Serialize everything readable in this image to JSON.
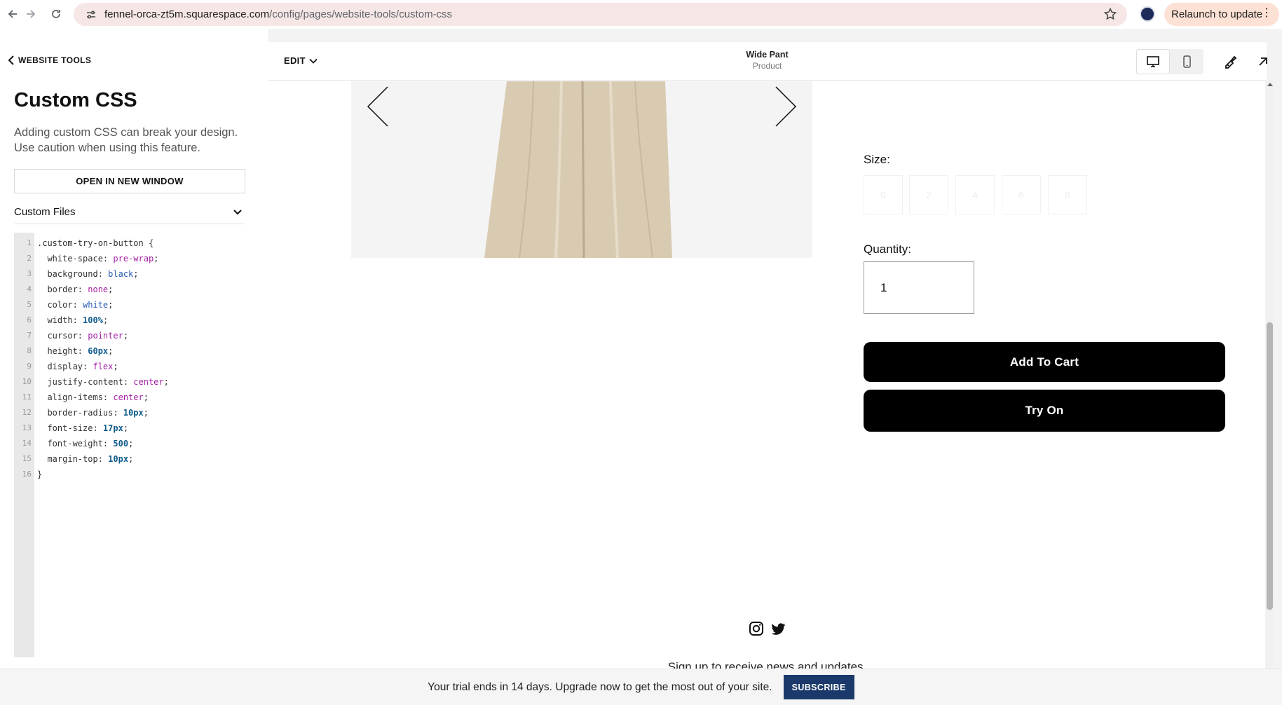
{
  "browser": {
    "url_host": "fennel-orca-zt5m.squarespace.com",
    "url_path": "/config/pages/website-tools/custom-css",
    "relaunch_label": "Relaunch to update"
  },
  "panel": {
    "back_label": "WEBSITE TOOLS",
    "title": "Custom CSS",
    "description": "Adding custom CSS can break your design. Use caution when using this feature.",
    "open_window_label": "OPEN IN NEW WINDOW",
    "custom_files_label": "Custom Files"
  },
  "code": {
    "line_numbers": [
      "1",
      "2",
      "3",
      "4",
      "5",
      "6",
      "7",
      "8",
      "9",
      "10",
      "11",
      "12",
      "13",
      "14",
      "15",
      "16"
    ],
    "lines": [
      [
        {
          "t": ".custom-try-on-button {",
          "c": ""
        }
      ],
      [
        {
          "t": "  white-space: ",
          "c": ""
        },
        {
          "t": "pre-wrap",
          "c": "kw"
        },
        {
          "t": ";",
          "c": ""
        }
      ],
      [
        {
          "t": "  background: ",
          "c": ""
        },
        {
          "t": "black",
          "c": "cl"
        },
        {
          "t": ";",
          "c": ""
        }
      ],
      [
        {
          "t": "  border: ",
          "c": ""
        },
        {
          "t": "none",
          "c": "kw"
        },
        {
          "t": ";",
          "c": ""
        }
      ],
      [
        {
          "t": "  color: ",
          "c": ""
        },
        {
          "t": "white",
          "c": "cl"
        },
        {
          "t": ";",
          "c": ""
        }
      ],
      [
        {
          "t": "  width: ",
          "c": ""
        },
        {
          "t": "100%",
          "c": "num"
        },
        {
          "t": ";",
          "c": ""
        }
      ],
      [
        {
          "t": "  cursor: ",
          "c": ""
        },
        {
          "t": "pointer",
          "c": "kw"
        },
        {
          "t": ";",
          "c": ""
        }
      ],
      [
        {
          "t": "  height: ",
          "c": ""
        },
        {
          "t": "60px",
          "c": "num"
        },
        {
          "t": ";",
          "c": ""
        }
      ],
      [
        {
          "t": "  display: ",
          "c": ""
        },
        {
          "t": "flex",
          "c": "kw"
        },
        {
          "t": ";",
          "c": ""
        }
      ],
      [
        {
          "t": "  justify-content: ",
          "c": ""
        },
        {
          "t": "center",
          "c": "kw"
        },
        {
          "t": ";",
          "c": ""
        }
      ],
      [
        {
          "t": "  align-items: ",
          "c": ""
        },
        {
          "t": "center",
          "c": "kw"
        },
        {
          "t": ";",
          "c": ""
        }
      ],
      [
        {
          "t": "  border-radius: ",
          "c": ""
        },
        {
          "t": "10px",
          "c": "num"
        },
        {
          "t": ";",
          "c": ""
        }
      ],
      [
        {
          "t": "  font-size: ",
          "c": ""
        },
        {
          "t": "17px",
          "c": "num"
        },
        {
          "t": ";",
          "c": ""
        }
      ],
      [
        {
          "t": "  font-weight: ",
          "c": ""
        },
        {
          "t": "500",
          "c": "num"
        },
        {
          "t": ";",
          "c": ""
        }
      ],
      [
        {
          "t": "  margin-top: ",
          "c": ""
        },
        {
          "t": "10px",
          "c": "num"
        },
        {
          "t": ";",
          "c": ""
        }
      ],
      [
        {
          "t": "}",
          "c": ""
        }
      ]
    ]
  },
  "preview": {
    "edit_label": "EDIT",
    "page_title": "Wide Pant",
    "page_subtitle": "Product",
    "icons": [
      "desktop-icon",
      "mobile-icon",
      "paintbrush-icon",
      "expand-arrow-icon"
    ]
  },
  "product": {
    "size_label": "Size:",
    "size_options": [
      "0",
      "2",
      "4",
      "6",
      "8"
    ],
    "quantity_label": "Quantity:",
    "quantity_value": "1",
    "add_to_cart_label": "Add To Cart",
    "try_on_label": "Try On",
    "social_icons": [
      "instagram-icon",
      "twitter-icon"
    ],
    "signup_text": "Sign up to receive news and updates."
  },
  "trial": {
    "message": "Your trial ends in 14 days. Upgrade now to get the most out of your site.",
    "subscribe_label": "SUBSCRIBE"
  },
  "colors": {
    "accent_navy": "#1b3a6b",
    "omnibox_bg": "#f6e7e6",
    "relaunch_bg": "#fde1d5",
    "pant_beige": "#d8cbb2"
  }
}
